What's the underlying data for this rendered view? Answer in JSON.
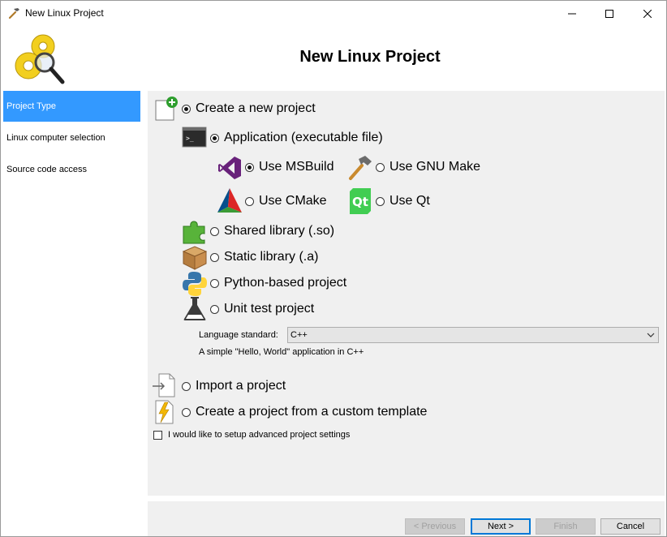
{
  "window": {
    "title": "New Linux Project"
  },
  "header": {
    "title": "New Linux Project"
  },
  "sidebar": {
    "items": [
      {
        "label": "Project Type",
        "active": true
      },
      {
        "label": "Linux computer selection",
        "active": false
      },
      {
        "label": "Source code access",
        "active": false
      }
    ]
  },
  "options": {
    "create_new": "Create a new project",
    "application": "Application (executable file)",
    "use_msbuild": "Use MSBuild",
    "use_gnu_make": "Use GNU Make",
    "use_cmake": "Use CMake",
    "use_qt": "Use Qt",
    "shared_library": "Shared library (.so)",
    "static_library": "Static library (.a)",
    "python_project": "Python-based project",
    "unit_test": "Unit test project",
    "import_project": "Import a project",
    "custom_template": "Create a project from a custom template"
  },
  "language": {
    "label": "Language standard:",
    "selected": "C++",
    "description": "A simple \"Hello, World\" application in C++"
  },
  "advanced_checkbox": {
    "label": "I would like to setup advanced project settings",
    "checked": false
  },
  "buttons": {
    "previous": "< Previous",
    "next": "Next >",
    "finish": "Finish",
    "cancel": "Cancel"
  },
  "colors": {
    "accent": "#3399ff",
    "panel": "#f0f0f0"
  }
}
